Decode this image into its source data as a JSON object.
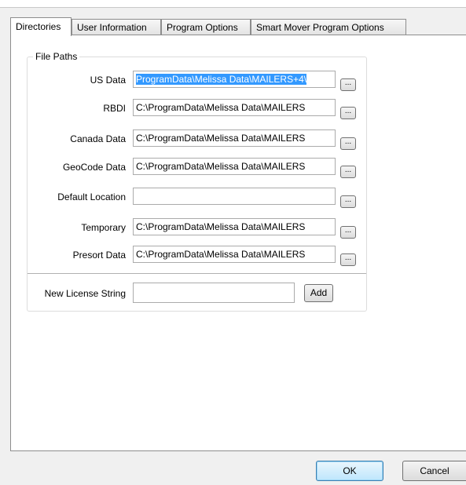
{
  "tabs": [
    "Directories",
    "User Information",
    "Program Options",
    "Smart Mover Program Options"
  ],
  "file_paths": {
    "legend": "File Paths",
    "rows": [
      {
        "label": "US Data",
        "value": "ProgramData\\Melissa Data\\MAILERS+4\\",
        "browse": "..."
      },
      {
        "label": "RBDI",
        "value": "C:\\ProgramData\\Melissa Data\\MAILERS",
        "browse": "..."
      },
      {
        "label": "Canada Data",
        "value": "C:\\ProgramData\\Melissa Data\\MAILERS",
        "browse": "..."
      },
      {
        "label": "GeoCode Data",
        "value": "C:\\ProgramData\\Melissa Data\\MAILERS",
        "browse": "..."
      },
      {
        "label": "Default Location",
        "value": "",
        "browse": "..."
      },
      {
        "label": "Temporary",
        "value": "C:\\ProgramData\\Melissa Data\\MAILERS",
        "browse": "..."
      },
      {
        "label": "Presort Data",
        "value": "C:\\ProgramData\\Melissa Data\\MAILERS",
        "browse": "..."
      }
    ]
  },
  "license": {
    "label": "New License String",
    "value": "",
    "add_label": "Add"
  },
  "footer": {
    "ok_label": "OK",
    "cancel_label": "Cancel"
  }
}
